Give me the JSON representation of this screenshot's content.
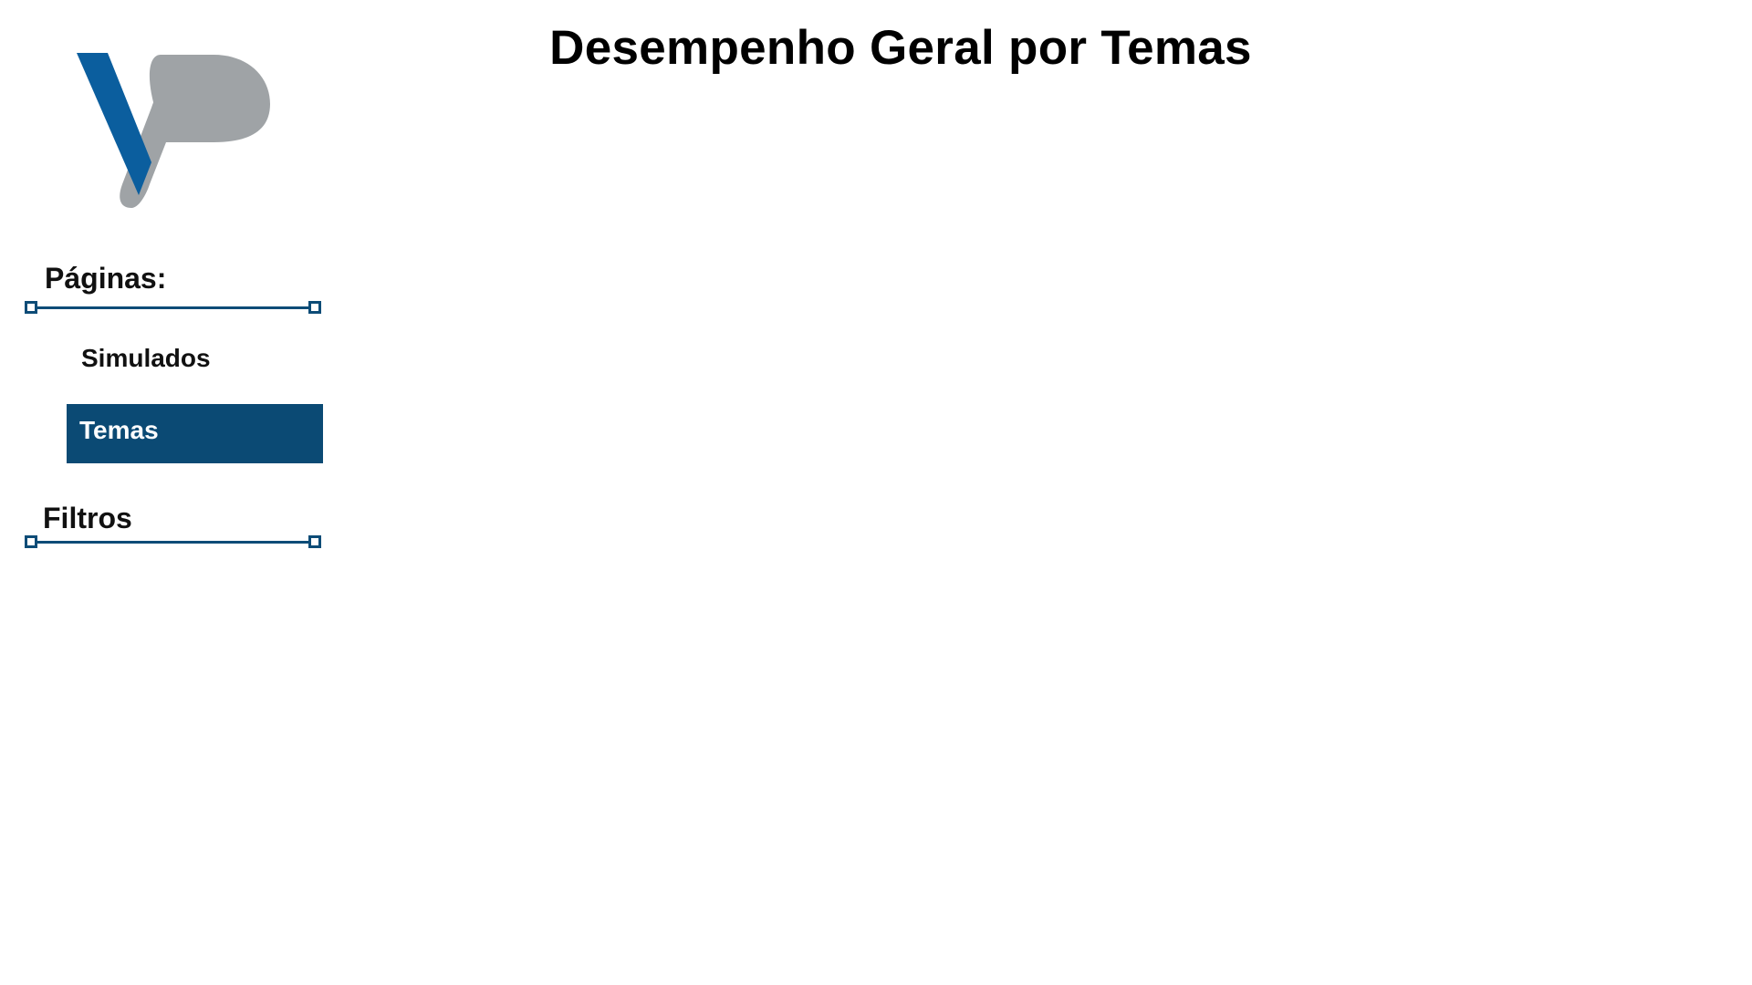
{
  "header": {
    "title": "Desempenho Geral por Temas"
  },
  "logo": {
    "name": "vp-logo",
    "colors": {
      "blue": "#0b5e9e",
      "gray": "#9fa3a6"
    }
  },
  "sidebar": {
    "pages_label": "Páginas:",
    "nav_items": [
      {
        "label": "Simulados",
        "active": false
      },
      {
        "label": "Temas",
        "active": true
      }
    ],
    "filters_label": "Filtros"
  },
  "theme": {
    "accent": "#0b4a74",
    "divider": "#0d4c77",
    "background": "#ffffff"
  }
}
